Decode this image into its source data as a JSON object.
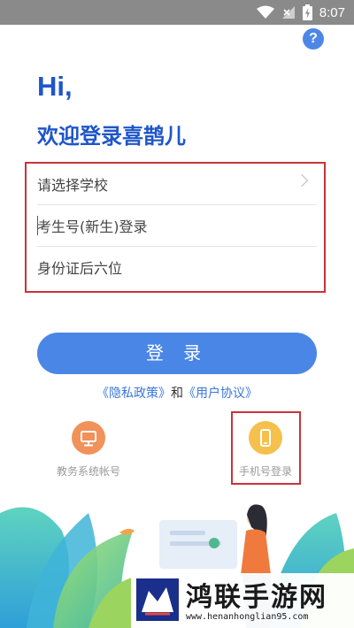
{
  "status_bar": {
    "time": "8:07"
  },
  "help": {
    "glyph": "?"
  },
  "greeting": {
    "hi": "Hi,",
    "welcome": "欢迎登录喜鹊儿"
  },
  "form": {
    "school": "请选择学校",
    "exam_id_placeholder": "考生号(新生)登录",
    "id_suffix_placeholder": "身份证后六位"
  },
  "login_button": "登 录",
  "agreement": {
    "privacy": "《隐私政策》",
    "and": "和",
    "user_agreement": "《用户协议》"
  },
  "login_options": [
    {
      "label": "教务系统帐号",
      "icon": "monitor-icon",
      "color": "#f0925a"
    },
    {
      "label": "手机号登录",
      "icon": "phone-icon",
      "color": "#f5c14c"
    }
  ],
  "watermark": {
    "title": "鸿联手游网",
    "url": "www.henanhonglian95.com"
  },
  "colors": {
    "accent": "#4a86e6",
    "title": "#1f56c9",
    "highlight_border": "#c8343b"
  }
}
